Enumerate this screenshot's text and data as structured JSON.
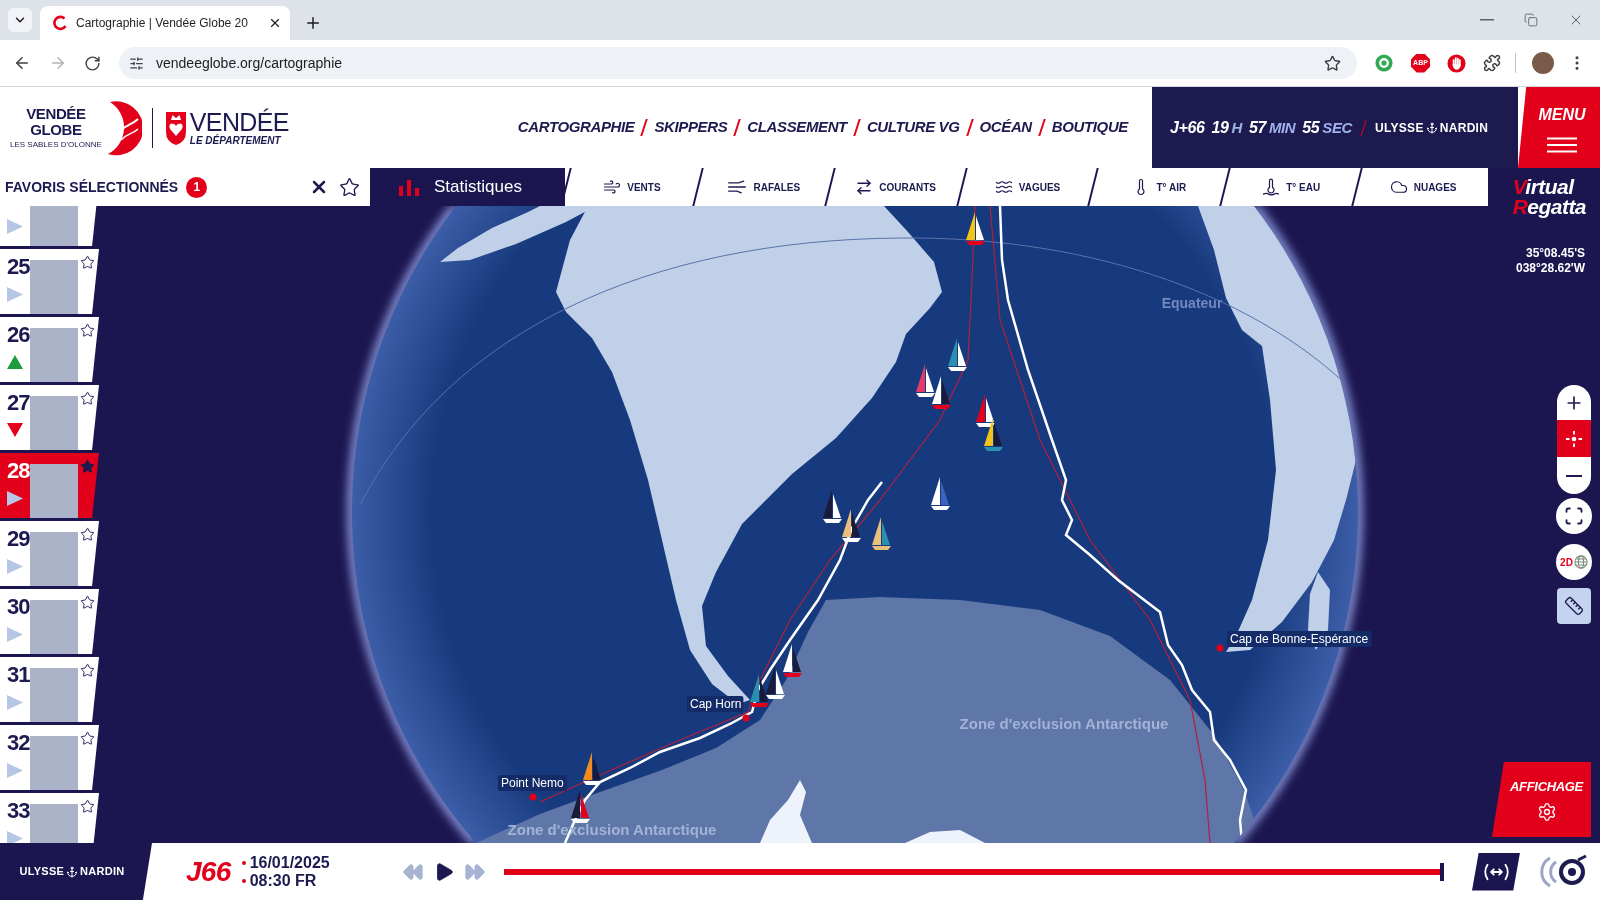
{
  "browser": {
    "tab_title": "Cartographie | Vendée Globe 20",
    "url": "vendeeglobe.org/cartographie",
    "extension_label": "ABP"
  },
  "header": {
    "event_logo": {
      "line1": "VENDÉE",
      "line2": "GLOBE",
      "tagline": "LES SABLES D'OLONNE"
    },
    "partner_logo": {
      "name": "VENDÉE",
      "subtitle": "LE DÉPARTEMENT"
    },
    "nav": [
      "CARTOGRAPHIE",
      "SKIPPERS",
      "CLASSEMENT",
      "CULTURE VG",
      "OCÉAN",
      "BOUTIQUE"
    ],
    "countdown": [
      {
        "value": "J+66"
      },
      {
        "value": "19",
        "unit": "H"
      },
      {
        "value": "57",
        "unit": "MIN"
      },
      {
        "value": "55",
        "unit": "SEC"
      }
    ],
    "sponsor": {
      "left": "ULYSSE",
      "right": "NARDIN"
    },
    "menu": "MENU"
  },
  "toolbar": {
    "favorites": {
      "title": "FAVORIS SÉLECTIONNÉS",
      "count": "1"
    },
    "statistics": "Statistiques",
    "layers": [
      {
        "kind": "wind",
        "label": "VENTS"
      },
      {
        "kind": "gusts",
        "label": "RAFALES"
      },
      {
        "kind": "currents",
        "label": "COURANTS"
      },
      {
        "kind": "waves",
        "label": "VAGUES"
      },
      {
        "kind": "air_temp",
        "label": "T° AIR"
      },
      {
        "kind": "water_temp",
        "label": "T° EAU"
      },
      {
        "kind": "clouds",
        "label": "NUAGES"
      }
    ],
    "game_logo": {
      "line1": "Virtual",
      "line2": "Regatta"
    }
  },
  "skippers": [
    {
      "kind": "steady"
    },
    {
      "rank": "25",
      "kind": "steady",
      "favorite": false
    },
    {
      "rank": "26",
      "kind": "up",
      "favorite": false
    },
    {
      "rank": "27",
      "kind": "down",
      "favorite": false
    },
    {
      "rank": "28",
      "kind": "steady",
      "favorite": true
    },
    {
      "rank": "29",
      "kind": "steady",
      "favorite": false
    },
    {
      "rank": "30",
      "kind": "steady",
      "favorite": false
    },
    {
      "rank": "31",
      "kind": "steady",
      "favorite": false
    },
    {
      "rank": "32",
      "kind": "steady",
      "favorite": false
    },
    {
      "rank": "33",
      "kind": "steady",
      "favorite": false
    }
  ],
  "map": {
    "labels": [
      {
        "kind": "line",
        "text": "Equateur"
      },
      {
        "kind": "place",
        "text": "Cap de Bonne-Espérance"
      },
      {
        "kind": "place",
        "text": "Cap Horn"
      },
      {
        "kind": "zone",
        "text": "Zone d'exclusion Antarctique"
      },
      {
        "kind": "place",
        "text": "Point Nemo"
      },
      {
        "kind": "zone",
        "text": "Zone d'exclusion Antarctique"
      }
    ],
    "coordinates": {
      "latitude": "35°08.45'S",
      "longitude": "038°28.62'W"
    },
    "view_mode": "2D",
    "display_button": "AFFICHAGE"
  },
  "timeline": {
    "day": "J66",
    "date": "16/01/2025",
    "time": "08:30 FR",
    "level": 1
  },
  "footer_sponsor": {
    "left": "ULYSSE",
    "right": "NARDIN"
  }
}
